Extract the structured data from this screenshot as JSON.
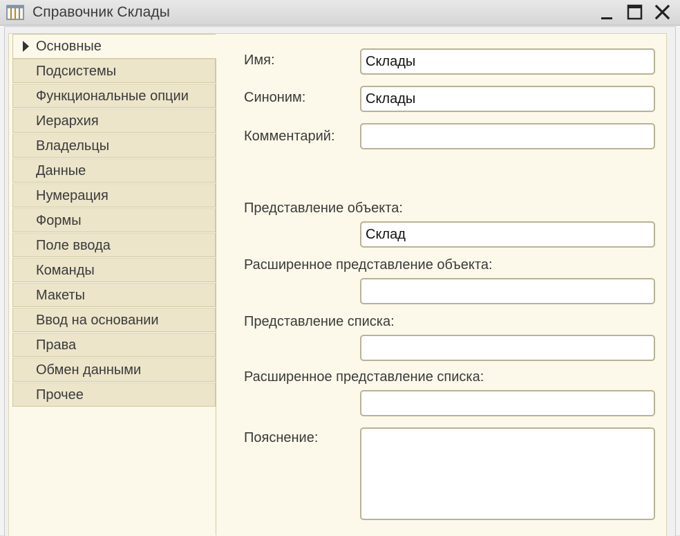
{
  "window": {
    "title": "Справочник Склады",
    "icon": "table-icon"
  },
  "tabs": [
    {
      "label": "Основные",
      "active": true
    },
    {
      "label": "Подсистемы"
    },
    {
      "label": "Функциональные опции"
    },
    {
      "label": "Иерархия"
    },
    {
      "label": "Владельцы"
    },
    {
      "label": "Данные"
    },
    {
      "label": "Нумерация"
    },
    {
      "label": "Формы"
    },
    {
      "label": "Поле ввода"
    },
    {
      "label": "Команды"
    },
    {
      "label": "Макеты"
    },
    {
      "label": "Ввод на основании"
    },
    {
      "label": "Права"
    },
    {
      "label": "Обмен данными"
    },
    {
      "label": "Прочее"
    }
  ],
  "form": {
    "name_label": "Имя:",
    "name_value": "Склады",
    "synonym_label": "Синоним:",
    "synonym_value": "Склады",
    "comment_label": "Комментарий:",
    "comment_value": "",
    "object_presentation_label": "Представление объекта:",
    "object_presentation_value": "Склад",
    "ext_object_presentation_label": "Расширенное представление объекта:",
    "ext_object_presentation_value": "",
    "list_presentation_label": "Представление списка:",
    "list_presentation_value": "",
    "ext_list_presentation_label": "Расширенное представление списка:",
    "ext_list_presentation_value": "",
    "explanation_label": "Пояснение:",
    "explanation_value": ""
  },
  "colors": {
    "content_bg": "#fcf9ea",
    "tab_bg": "#ece5ca",
    "field_border": "#b8b296"
  }
}
